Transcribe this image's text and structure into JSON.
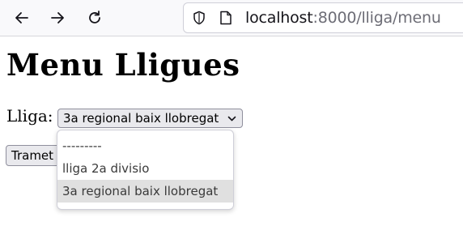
{
  "browser": {
    "url_host": "localhost",
    "url_rest": ":8000/lliga/menu",
    "icons": [
      "back-arrow-icon",
      "forward-arrow-icon",
      "reload-icon",
      "shield-icon",
      "page-icon"
    ]
  },
  "page": {
    "title": "Menu Lligues",
    "lliga_label": "Lliga:",
    "select_value": "3a regional baix llobregat",
    "submit_label": "Tramet",
    "options": [
      "---------",
      "lliga 2a divisio",
      "3a regional baix llobregat"
    ],
    "selected_option_index": 2
  }
}
